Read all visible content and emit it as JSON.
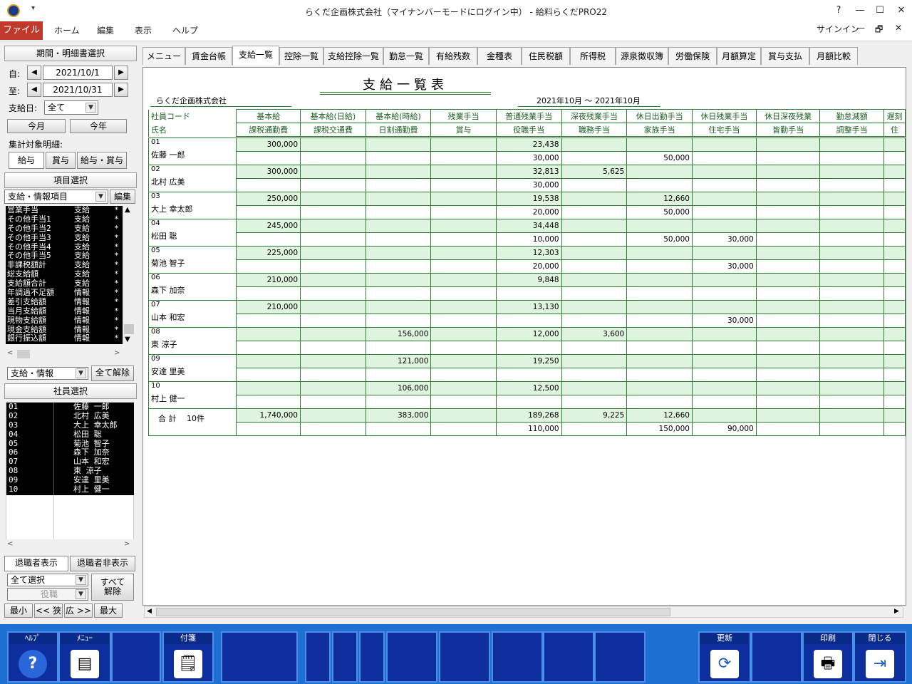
{
  "window": {
    "title": "らくだ企画株式会社（マイナンバーモードにログイン中） - 給料らくだPRO22",
    "qa": "▾",
    "help": "?",
    "min": "—",
    "max": "☐",
    "close": "✕"
  },
  "ribbon": {
    "file": "ファイル",
    "tabs": [
      "ホーム",
      "編集",
      "表示",
      "ヘルプ"
    ],
    "signin": "サインイン",
    "rmin": "—",
    "rrestore": "🗗",
    "rclose": "✕"
  },
  "left": {
    "period_header": "期間・明細書選択",
    "from_label": "自:",
    "from_value": "2021/10/1",
    "to_label": "至:",
    "to_value": "2021/10/31",
    "payday_label": "支給日:",
    "payday_value": "全て",
    "this_month": "今月",
    "this_year": "今年",
    "target_label": "集計対象明細:",
    "target_buttons": [
      "給与",
      "賞与",
      "給与・賞与"
    ],
    "item_header": "項目選択",
    "item_dropdown": "支給・情報項目",
    "edit_button": "編集",
    "items": [
      [
        "営業手当",
        "支給",
        "*"
      ],
      [
        "その他手当1",
        "支給",
        "*"
      ],
      [
        "その他手当2",
        "支給",
        "*"
      ],
      [
        "その他手当3",
        "支給",
        "*"
      ],
      [
        "その他手当4",
        "支給",
        "*"
      ],
      [
        "その他手当5",
        "支給",
        "*"
      ],
      [
        "非課税額計",
        "支給",
        "*"
      ],
      [
        "総支給額",
        "支給",
        "*"
      ],
      [
        "支給額合計",
        "支給",
        "*"
      ],
      [
        "年調過不足額",
        "情報",
        "*"
      ],
      [
        "差引支給額",
        "情報",
        "*"
      ],
      [
        "当月支給額",
        "情報",
        "*"
      ],
      [
        "現物支給額",
        "情報",
        "*"
      ],
      [
        "現金支給額",
        "情報",
        "*"
      ],
      [
        "銀行振込額",
        "情報",
        "*"
      ]
    ],
    "filter_dropdown": "支給・情報",
    "clear_all": "全て解除",
    "employee_header": "社員選択",
    "employees": [
      [
        "01",
        "佐藤 一郎"
      ],
      [
        "02",
        "北村 広美"
      ],
      [
        "03",
        "大上 幸太郎"
      ],
      [
        "04",
        "松田 聡"
      ],
      [
        "05",
        "菊池 智子"
      ],
      [
        "06",
        "森下 加奈"
      ],
      [
        "07",
        "山本 和宏"
      ],
      [
        "08",
        "東 涼子"
      ],
      [
        "09",
        "安達 里美"
      ],
      [
        "10",
        "村上 健一"
      ]
    ],
    "show_retired": "退職者表示",
    "hide_retired": "退職者非表示",
    "select_all_dropdown": "全て選択",
    "position_dropdown": "役職",
    "release_all": "すべて\n解除",
    "zoom_buttons": [
      "最小",
      "<< 狭",
      "広 >>",
      "最大"
    ]
  },
  "tabs": [
    "メニュー",
    "賃金台帳",
    "支給一覧",
    "控除一覧",
    "支給控除一覧",
    "勤怠一覧",
    "有給残数",
    "金種表",
    "住民税額",
    "所得税",
    "源泉徴収簿",
    "労働保険",
    "月額算定",
    "賞与支払",
    "月額比較"
  ],
  "active_tab": 2,
  "report": {
    "title": "支給一覧表",
    "company": "らくだ企画株式会社",
    "period": "2021年10月 〜 2021年10月",
    "header_left_top": "社員コード",
    "header_left_bottom": "氏名",
    "col_top": [
      "基本給",
      "基本給(日給)",
      "基本給(時給)",
      "残業手当",
      "普通残業手当",
      "深夜残業手当",
      "休日出勤手当",
      "休日残業手当",
      "休日深夜残業",
      "勤怠減額",
      "遅刻"
    ],
    "col_bottom": [
      "課税通勤費",
      "課税交通費",
      "日割通勤費",
      "賞与",
      "役職手当",
      "職務手当",
      "家族手当",
      "住宅手当",
      "皆勤手当",
      "調整手当",
      "住"
    ],
    "rows": [
      {
        "code": "01",
        "name": "佐藤 一郎",
        "a": [
          "300,000",
          "",
          "",
          "",
          "23,438",
          "",
          "",
          "",
          "",
          "",
          ""
        ],
        "b": [
          "",
          "",
          "",
          "",
          "30,000",
          "",
          "50,000",
          "",
          "",
          "",
          ""
        ]
      },
      {
        "code": "02",
        "name": "北村 広美",
        "a": [
          "300,000",
          "",
          "",
          "",
          "32,813",
          "5,625",
          "",
          "",
          "",
          "",
          ""
        ],
        "b": [
          "",
          "",
          "",
          "",
          "30,000",
          "",
          "",
          "",
          "",
          "",
          ""
        ]
      },
      {
        "code": "03",
        "name": "大上 幸太郎",
        "a": [
          "250,000",
          "",
          "",
          "",
          "19,538",
          "",
          "12,660",
          "",
          "",
          "",
          ""
        ],
        "b": [
          "",
          "",
          "",
          "",
          "20,000",
          "",
          "50,000",
          "",
          "",
          "",
          ""
        ]
      },
      {
        "code": "04",
        "name": "松田 聡",
        "a": [
          "245,000",
          "",
          "",
          "",
          "34,448",
          "",
          "",
          "",
          "",
          "",
          ""
        ],
        "b": [
          "",
          "",
          "",
          "",
          "10,000",
          "",
          "50,000",
          "30,000",
          "",
          "",
          ""
        ]
      },
      {
        "code": "05",
        "name": "菊池 智子",
        "a": [
          "225,000",
          "",
          "",
          "",
          "12,303",
          "",
          "",
          "",
          "",
          "",
          ""
        ],
        "b": [
          "",
          "",
          "",
          "",
          "20,000",
          "",
          "",
          "30,000",
          "",
          "",
          ""
        ]
      },
      {
        "code": "06",
        "name": "森下 加奈",
        "a": [
          "210,000",
          "",
          "",
          "",
          "9,848",
          "",
          "",
          "",
          "",
          "",
          ""
        ],
        "b": [
          "",
          "",
          "",
          "",
          "",
          "",
          "",
          "",
          "",
          "",
          ""
        ]
      },
      {
        "code": "07",
        "name": "山本 和宏",
        "a": [
          "210,000",
          "",
          "",
          "",
          "13,130",
          "",
          "",
          "",
          "",
          "",
          ""
        ],
        "b": [
          "",
          "",
          "",
          "",
          "",
          "",
          "",
          "30,000",
          "",
          "",
          ""
        ]
      },
      {
        "code": "08",
        "name": "東 涼子",
        "a": [
          "",
          "",
          "156,000",
          "",
          "12,000",
          "3,600",
          "",
          "",
          "",
          "",
          ""
        ],
        "b": [
          "",
          "",
          "",
          "",
          "",
          "",
          "",
          "",
          "",
          "",
          ""
        ]
      },
      {
        "code": "09",
        "name": "安達 里美",
        "a": [
          "",
          "",
          "121,000",
          "",
          "19,250",
          "",
          "",
          "",
          "",
          "",
          ""
        ],
        "b": [
          "",
          "",
          "",
          "",
          "",
          "",
          "",
          "",
          "",
          "",
          ""
        ]
      },
      {
        "code": "10",
        "name": "村上 健一",
        "a": [
          "",
          "",
          "106,000",
          "",
          "12,500",
          "",
          "",
          "",
          "",
          "",
          ""
        ],
        "b": [
          "",
          "",
          "",
          "",
          "",
          "",
          "",
          "",
          "",
          "",
          ""
        ]
      }
    ],
    "total": {
      "label": "合 計　 10件",
      "a": [
        "1,740,000",
        "",
        "383,000",
        "",
        "189,268",
        "9,225",
        "12,660",
        "",
        "",
        "",
        ""
      ],
      "b": [
        "",
        "",
        "",
        "",
        "110,000",
        "",
        "150,000",
        "90,000",
        "",
        "",
        ""
      ]
    }
  },
  "footer": {
    "keys": [
      {
        "label": "ﾍﾙﾌﾟ",
        "icon": "help-icon",
        "glyph": "?"
      },
      {
        "label": "ﾒﾆｭｰ",
        "icon": "menu-icon",
        "glyph": "▤"
      },
      {
        "label": "",
        "icon": "",
        "glyph": ""
      },
      {
        "label": "付箋",
        "icon": "sticky-note-icon",
        "glyph": "🗒"
      },
      {
        "label": "",
        "icon": "",
        "glyph": ""
      },
      {
        "label": "",
        "icon": "",
        "glyph": ""
      },
      {
        "label": "",
        "icon": "",
        "glyph": ""
      },
      {
        "label": "",
        "icon": "",
        "glyph": ""
      },
      {
        "label": "",
        "icon": "",
        "glyph": ""
      },
      {
        "label": "",
        "icon": "",
        "glyph": ""
      },
      {
        "label": "",
        "icon": "",
        "glyph": ""
      },
      {
        "label": "",
        "icon": "",
        "glyph": ""
      },
      {
        "label": "",
        "icon": "",
        "glyph": ""
      },
      {
        "label": "更新",
        "icon": "refresh-icon",
        "glyph": "⟳"
      },
      {
        "label": "",
        "icon": "",
        "glyph": ""
      },
      {
        "label": "印刷",
        "icon": "print-icon",
        "glyph": "🖶"
      },
      {
        "label": "閉じる",
        "icon": "exit-icon",
        "glyph": "⇥"
      }
    ]
  }
}
